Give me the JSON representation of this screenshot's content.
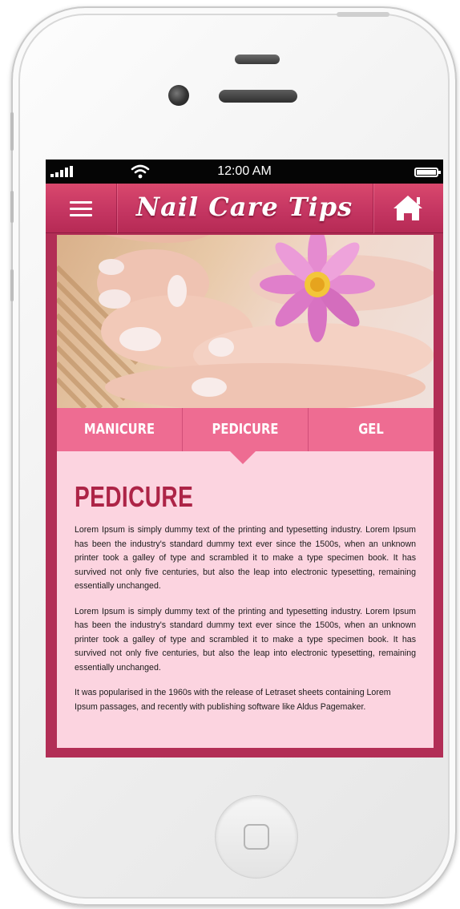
{
  "status_bar": {
    "time": "12:00 AM"
  },
  "navbar": {
    "title": "Nail Care Tips"
  },
  "tabs": [
    {
      "label": "MANICURE"
    },
    {
      "label": "PEDICURE"
    },
    {
      "label": "GEL"
    }
  ],
  "content": {
    "heading": "PEDICURE",
    "paragraphs": [
      "Lorem Ipsum is simply dummy text of the printing and typesetting industry. Lorem Ipsum has been the industry's standard dummy text ever since the 1500s, when an unknown printer took a galley of type and scrambled it to make a type specimen book. It has survived not only five centuries, but also the leap into electronic typesetting, remaining essentially unchanged.",
      "Lorem Ipsum is simply dummy text of the printing and typesetting industry. Lorem Ipsum has been the industry's standard dummy text ever since the 1500s, when an unknown printer took a galley of type and scrambled it to make a type specimen book. It has survived not only five centuries, but also the leap into electronic typesetting, remaining essentially unchanged.",
      "It was popularised in the 1960s with the release of Letraset sheets containing Lorem Ipsum passages, and recently with publishing software like Aldus Pagemaker."
    ]
  },
  "colors": {
    "navbar": "#c53662",
    "frame_border": "#b22e56",
    "tab_bar": "#ee6c92",
    "content_bg": "#fcd4e0",
    "heading": "#ad2447"
  },
  "icons": {
    "menu": "hamburger-icon",
    "home": "home-icon",
    "signal": "signal-icon",
    "wifi": "wifi-icon",
    "battery": "battery-icon"
  },
  "active_tab": "PEDICURE"
}
